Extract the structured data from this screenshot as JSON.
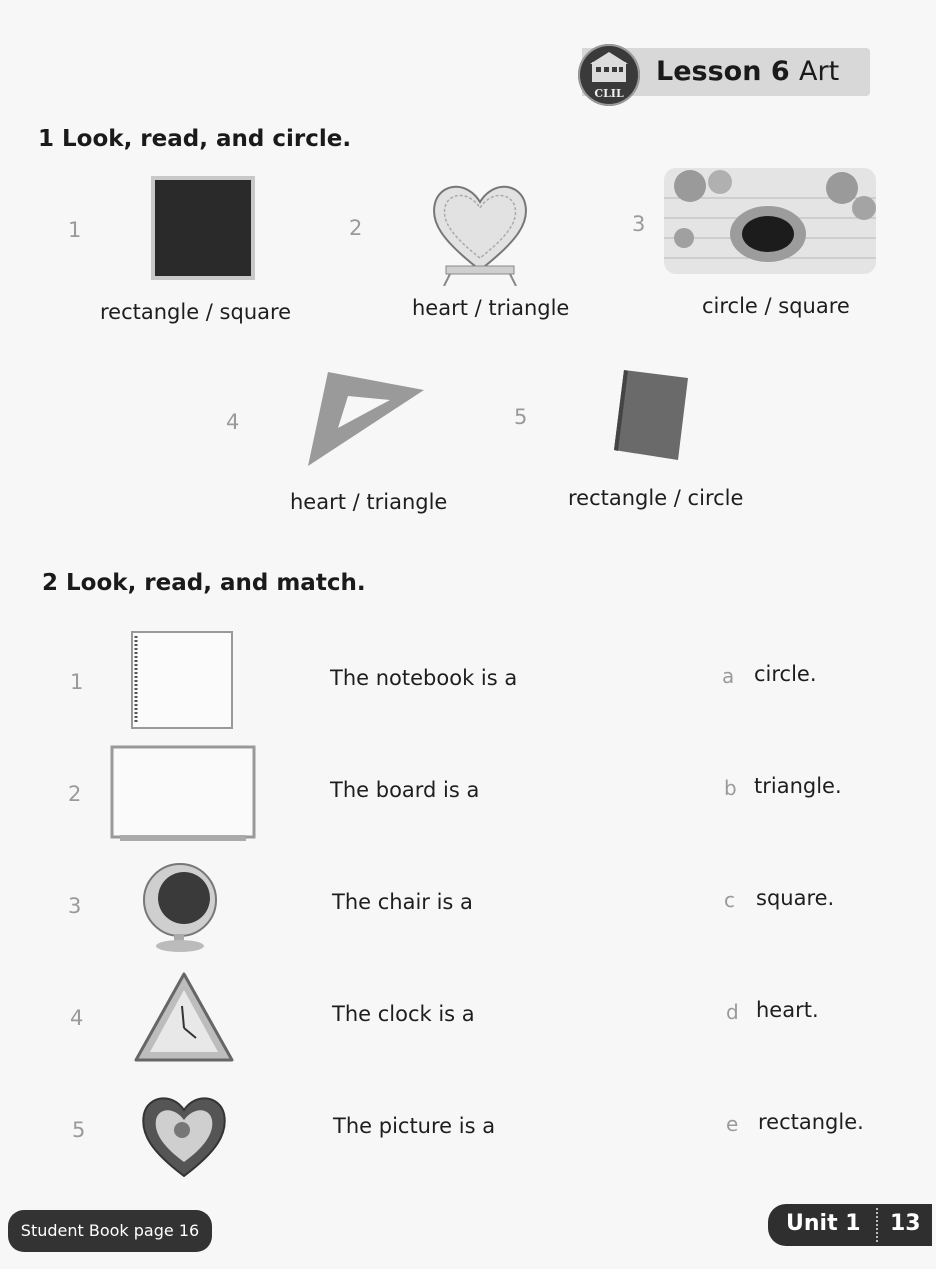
{
  "header": {
    "badge_text": "CLIL",
    "lesson_label": "Lesson 6",
    "subject": "Art"
  },
  "exercise1": {
    "title": "1  Look, read, and circle.",
    "items": [
      {
        "number": "1",
        "options": "rectangle / square",
        "picture": "square-board"
      },
      {
        "number": "2",
        "options": "heart / triangle",
        "picture": "heart-chair"
      },
      {
        "number": "3",
        "options": "circle / square",
        "picture": "round-window"
      },
      {
        "number": "4",
        "options": "heart / triangle",
        "picture": "triangle-ruler"
      },
      {
        "number": "5",
        "options": "rectangle / circle",
        "picture": "book"
      }
    ]
  },
  "exercise2": {
    "title": "2  Look, read, and match.",
    "rows": [
      {
        "number": "1",
        "sentence": "The notebook is a",
        "letter": "a",
        "answer": "circle.",
        "picture": "notebook"
      },
      {
        "number": "2",
        "sentence": "The board is a",
        "letter": "b",
        "answer": "triangle.",
        "picture": "whiteboard"
      },
      {
        "number": "3",
        "sentence": "The chair is a",
        "letter": "c",
        "answer": "square.",
        "picture": "ball-chair"
      },
      {
        "number": "4",
        "sentence": "The clock is a",
        "letter": "d",
        "answer": "heart.",
        "picture": "triangle-clock"
      },
      {
        "number": "5",
        "sentence": "The picture is a",
        "letter": "e",
        "answer": "rectangle.",
        "picture": "heart-frame"
      }
    ]
  },
  "footer": {
    "book_ref": "Student Book page 16",
    "unit": "Unit 1",
    "page": "13"
  }
}
